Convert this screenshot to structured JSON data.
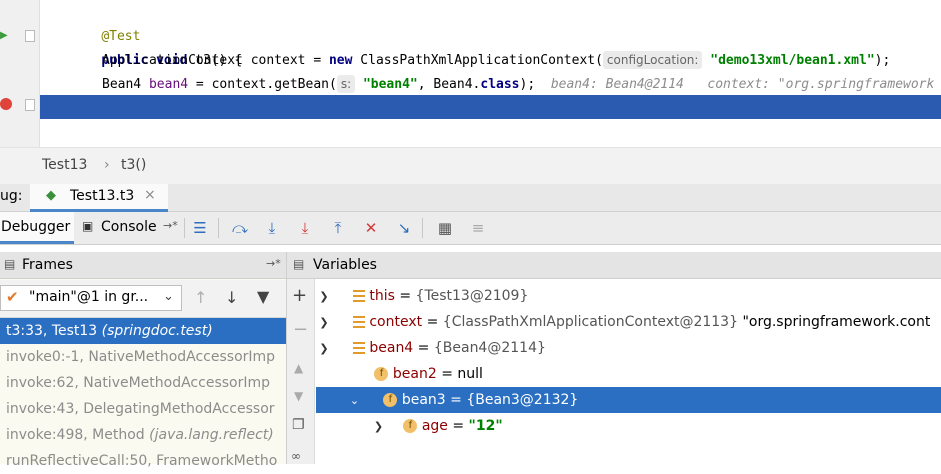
{
  "editor": {
    "annotation": "@Test",
    "method_kw1": "public",
    "method_kw2": "void",
    "method_sig": "t3() {",
    "line3_type": "ApplicationContext context = ",
    "line3_new": "new",
    "line3_class": " ClassPathXmlApplicationContext(",
    "line3_hint": "configLocation:",
    "line3_str": "\"demo13xml/bean1.xml\"",
    "line3_end": ");",
    "line4_start": "Bean4 ",
    "line4_var": "bean4",
    "line4_mid": " = context.getBean(",
    "line4_hint": "s:",
    "line4_str": "\"bean4\"",
    "line4_mid2": ", Bean4.",
    "line4_kw": "class",
    "line4_end": ");",
    "line4_inline": "bean4: Bean4@2114   context: \"org.springframework",
    "close_brace": "}"
  },
  "breadcrumb": {
    "class_name": "Test13",
    "separator": "›",
    "method": "t3()"
  },
  "debug": {
    "label": "ug:",
    "tab_name": "Test13.t3",
    "tab_close": "×",
    "debugger_tab": "Debugger",
    "console_tab": "Console",
    "console_suffix": "→*"
  },
  "frames": {
    "title": "Frames",
    "thread": "\"main\"@1 in gr...",
    "items": [
      {
        "main": "t3:33, Test13 ",
        "pkg": "(springdoc.test)"
      },
      {
        "main": "invoke0:-1, NativeMethodAccessorImp",
        "pkg": ""
      },
      {
        "main": "invoke:62, NativeMethodAccessorImp",
        "pkg": ""
      },
      {
        "main": "invoke:43, DelegatingMethodAccessor",
        "pkg": ""
      },
      {
        "main": "invoke:498, Method ",
        "pkg": "(java.lang.reflect)"
      },
      {
        "main": "runReflectiveCall:50, FrameworkMetho",
        "pkg": ""
      }
    ]
  },
  "variables": {
    "title": "Variables",
    "rows": [
      {
        "name": "this",
        "eq": " = ",
        "value": "{Test13@2109}",
        "extra": ""
      },
      {
        "name": "context",
        "eq": " = ",
        "value": "{ClassPathXmlApplicationContext@2113}",
        "extra": " \"org.springframework.cont"
      },
      {
        "name": "bean4",
        "eq": " = ",
        "value": "{Bean4@2114}",
        "extra": ""
      },
      {
        "name": "bean2",
        "eq": " = ",
        "value": "null",
        "extra": ""
      },
      {
        "name": "bean3",
        "eq": " = ",
        "value": "{Bean3@2132}",
        "extra": ""
      },
      {
        "name": "age",
        "eq": " = ",
        "value": "\"12\"",
        "extra": ""
      }
    ]
  },
  "colors": {
    "selection": "#2a6fc2",
    "current_line": "#2a5bb0",
    "keyword": "#000080",
    "string": "#008000"
  }
}
